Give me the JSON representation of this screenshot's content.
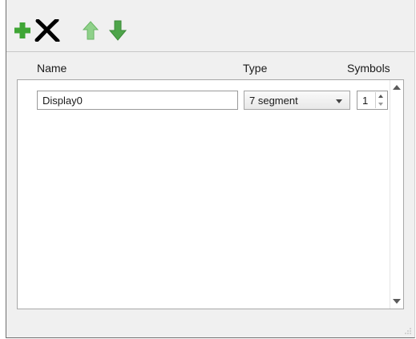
{
  "toolbar": {
    "buttons": [
      {
        "name": "add-icon",
        "color": "#3fa535"
      },
      {
        "name": "remove-icon",
        "color": "#000000"
      },
      {
        "name": "move-up-icon",
        "color": "#8fd18a"
      },
      {
        "name": "move-down-icon",
        "color": "#4ea54a"
      }
    ]
  },
  "columns": {
    "name": "Name",
    "type": "Type",
    "symbols": "Symbols"
  },
  "rows": [
    {
      "name": "Display0",
      "type": "7 segment",
      "symbols": "1"
    }
  ]
}
